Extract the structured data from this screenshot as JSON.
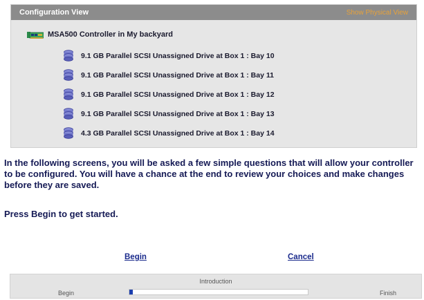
{
  "config_view": {
    "title": "Configuration View",
    "physical_view_link": "Show Physical View",
    "controller": {
      "label": "MSA500 Controller in My backyard",
      "icon": "controller-icon"
    },
    "drives": [
      {
        "label": "9.1 GB Parallel SCSI Unassigned Drive at Box 1 : Bay 10",
        "icon": "disk-drive-icon"
      },
      {
        "label": "9.1 GB Parallel SCSI Unassigned Drive at Box 1 : Bay 11",
        "icon": "disk-drive-icon"
      },
      {
        "label": "9.1 GB Parallel SCSI Unassigned Drive at Box 1 : Bay 12",
        "icon": "disk-drive-icon"
      },
      {
        "label": "9.1 GB Parallel SCSI Unassigned Drive at Box 1 : Bay 13",
        "icon": "disk-drive-icon"
      },
      {
        "label": "4.3 GB Parallel SCSI Unassigned Drive at Box 1 : Bay 14",
        "icon": "disk-drive-icon"
      }
    ]
  },
  "intro": {
    "paragraph": "In the following screens, you will be asked a few simple questions that will allow your controller to be configured. You will have a chance at the end to review your choices and make changes before they are saved.",
    "press_begin": "Press Begin to get started."
  },
  "actions": {
    "begin_label": "Begin",
    "cancel_label": "Cancel"
  },
  "progress": {
    "step_title": "Introduction",
    "start_label": "Begin",
    "end_label": "Finish",
    "fraction": 0.02
  },
  "colors": {
    "header_bg": "#8c8c8c",
    "panel_bg": "#e6e6e6",
    "link_accent": "#e8a23a",
    "text_navy": "#151a55",
    "progress_fill": "#1c3fae"
  }
}
